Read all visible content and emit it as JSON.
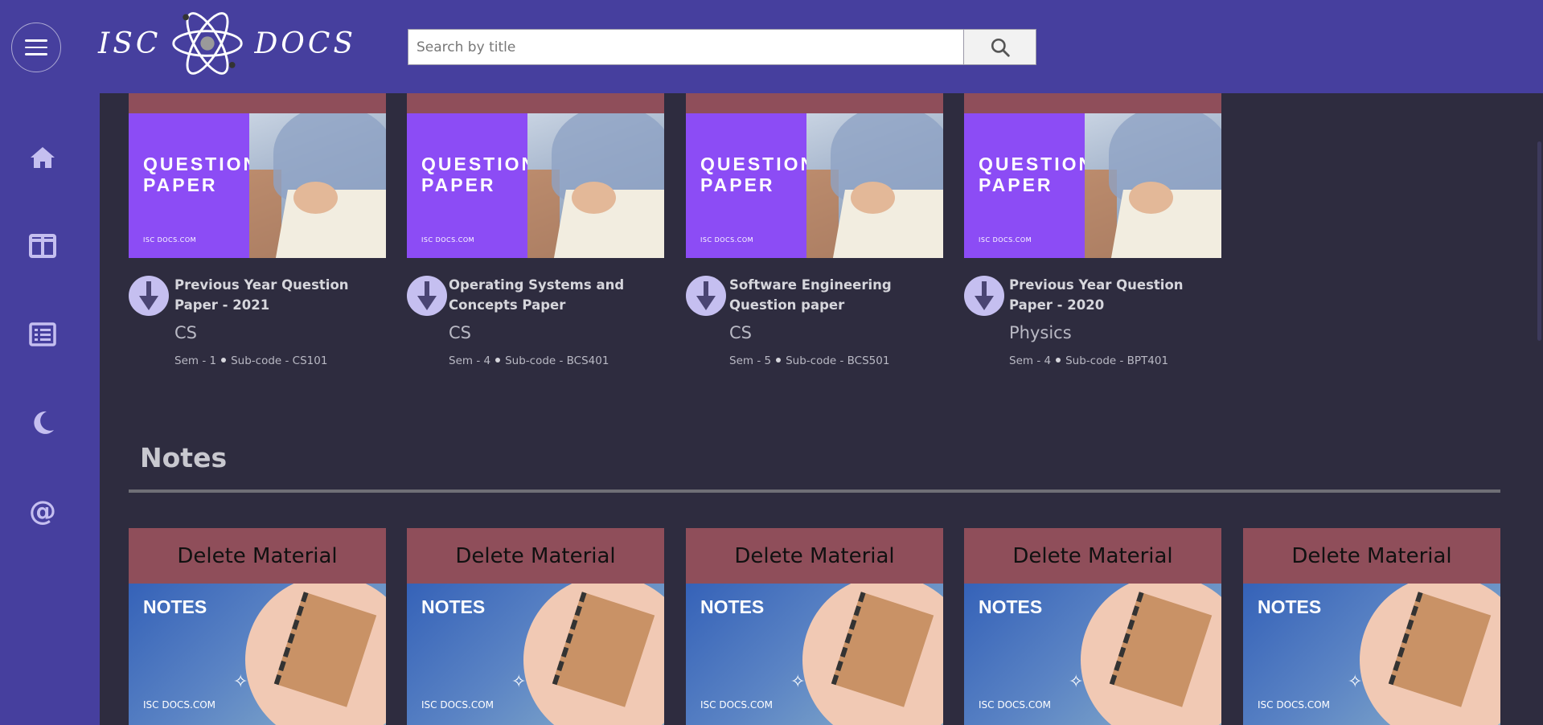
{
  "header": {
    "logo_left": "ISC",
    "logo_right": "DOCS",
    "search_placeholder": "Search by title"
  },
  "sidebar": {
    "items": [
      {
        "icon": "home-icon"
      },
      {
        "icon": "layout-icon"
      },
      {
        "icon": "list-icon"
      },
      {
        "icon": "moon-icon"
      },
      {
        "icon": "at-icon"
      }
    ]
  },
  "question_papers": [
    {
      "thumb_title_1": "QUESTION",
      "thumb_title_2": "PAPER",
      "thumb_site": "ISC DOCS.COM",
      "name": "Previous Year Question Paper - 2021",
      "subject": "CS",
      "sem": "Sem - 1",
      "subcode": "Sub-code - CS101"
    },
    {
      "thumb_title_1": "QUESTION",
      "thumb_title_2": "PAPER",
      "thumb_site": "ISC DOCS.COM",
      "name": "Operating Systems and Concepts Paper",
      "subject": "CS",
      "sem": "Sem - 4",
      "subcode": "Sub-code - BCS401"
    },
    {
      "thumb_title_1": "QUESTION",
      "thumb_title_2": "PAPER",
      "thumb_site": "ISC DOCS.COM",
      "name": "Software Engineering Question paper",
      "subject": "CS",
      "sem": "Sem - 5",
      "subcode": "Sub-code - BCS501"
    },
    {
      "thumb_title_1": "QUESTION",
      "thumb_title_2": "PAPER",
      "thumb_site": "ISC DOCS.COM",
      "name": "Previous Year Question Paper - 2020",
      "subject": "Physics",
      "sem": "Sem - 4",
      "subcode": "Sub-code - BPT401"
    }
  ],
  "notes_section": {
    "heading": "Notes",
    "cards": [
      {
        "delete_label": "Delete Material",
        "thumb_title": "NOTES",
        "thumb_site": "ISC DOCS.COM"
      },
      {
        "delete_label": "Delete Material",
        "thumb_title": "NOTES",
        "thumb_site": "ISC DOCS.COM"
      },
      {
        "delete_label": "Delete Material",
        "thumb_title": "NOTES",
        "thumb_site": "ISC DOCS.COM"
      },
      {
        "delete_label": "Delete Material",
        "thumb_title": "NOTES",
        "thumb_site": "ISC DOCS.COM"
      },
      {
        "delete_label": "Delete Material",
        "thumb_title": "NOTES",
        "thumb_site": "ISC DOCS.COM"
      }
    ]
  },
  "colors": {
    "header": "#463f9e",
    "background": "#2e2c3f",
    "accent_strip": "#8f4e5a",
    "thumb_purple": "#8c4cf5"
  }
}
